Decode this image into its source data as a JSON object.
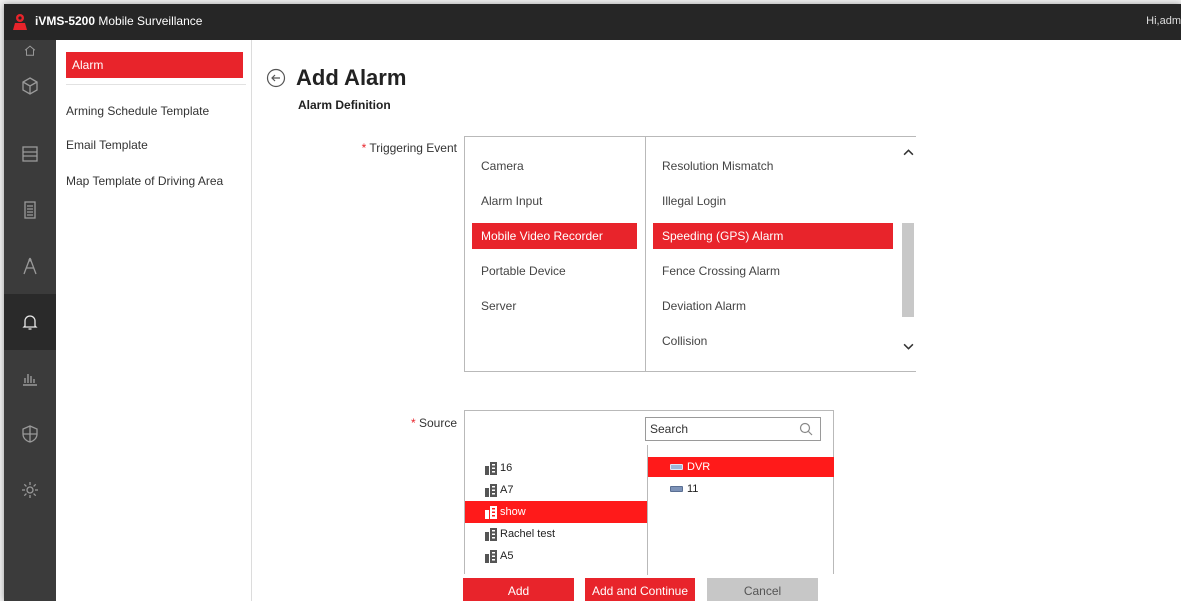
{
  "app": {
    "title_bold": "iVMS-5200",
    "title_rest": " Mobile Surveillance",
    "greeting": "Hi,adm"
  },
  "sidebar_icons": [
    "home-icon",
    "cube-icon",
    "storage-icon",
    "building-icon",
    "compass-icon",
    "bell-icon",
    "chart-icon",
    "shield-icon",
    "gear-icon"
  ],
  "submenu": {
    "items": [
      "Alarm",
      "Arming Schedule Template",
      "Email Template",
      "Map Template of Driving Area"
    ],
    "active_index": 0
  },
  "page": {
    "title": "Add Alarm",
    "section": "Alarm Definition"
  },
  "triggering_event": {
    "required_mark": "*",
    "label": "Triggering Event",
    "categories": [
      "Camera",
      "Alarm Input",
      "Mobile Video Recorder",
      "Portable Device",
      "Server"
    ],
    "selected_category": "Mobile Video Recorder",
    "events": [
      "Resolution Mismatch",
      "Illegal Login",
      "Speeding (GPS) Alarm",
      "Fence Crossing Alarm",
      "Deviation Alarm",
      "Collision"
    ],
    "selected_event": "Speeding (GPS) Alarm"
  },
  "source": {
    "required_mark": "*",
    "label": "Source",
    "search_placeholder": "Search",
    "groups": [
      "16",
      "A7",
      "show",
      "Rachel test",
      "A5"
    ],
    "selected_group": "show",
    "devices": [
      "DVR",
      "11"
    ],
    "selected_device": "DVR"
  },
  "buttons": {
    "add": "Add",
    "add_continue": "Add and Continue",
    "cancel": "Cancel"
  },
  "colors": {
    "accent": "#e8242b",
    "titlebar": "#262626",
    "iconbar": "#3b3b3b"
  }
}
